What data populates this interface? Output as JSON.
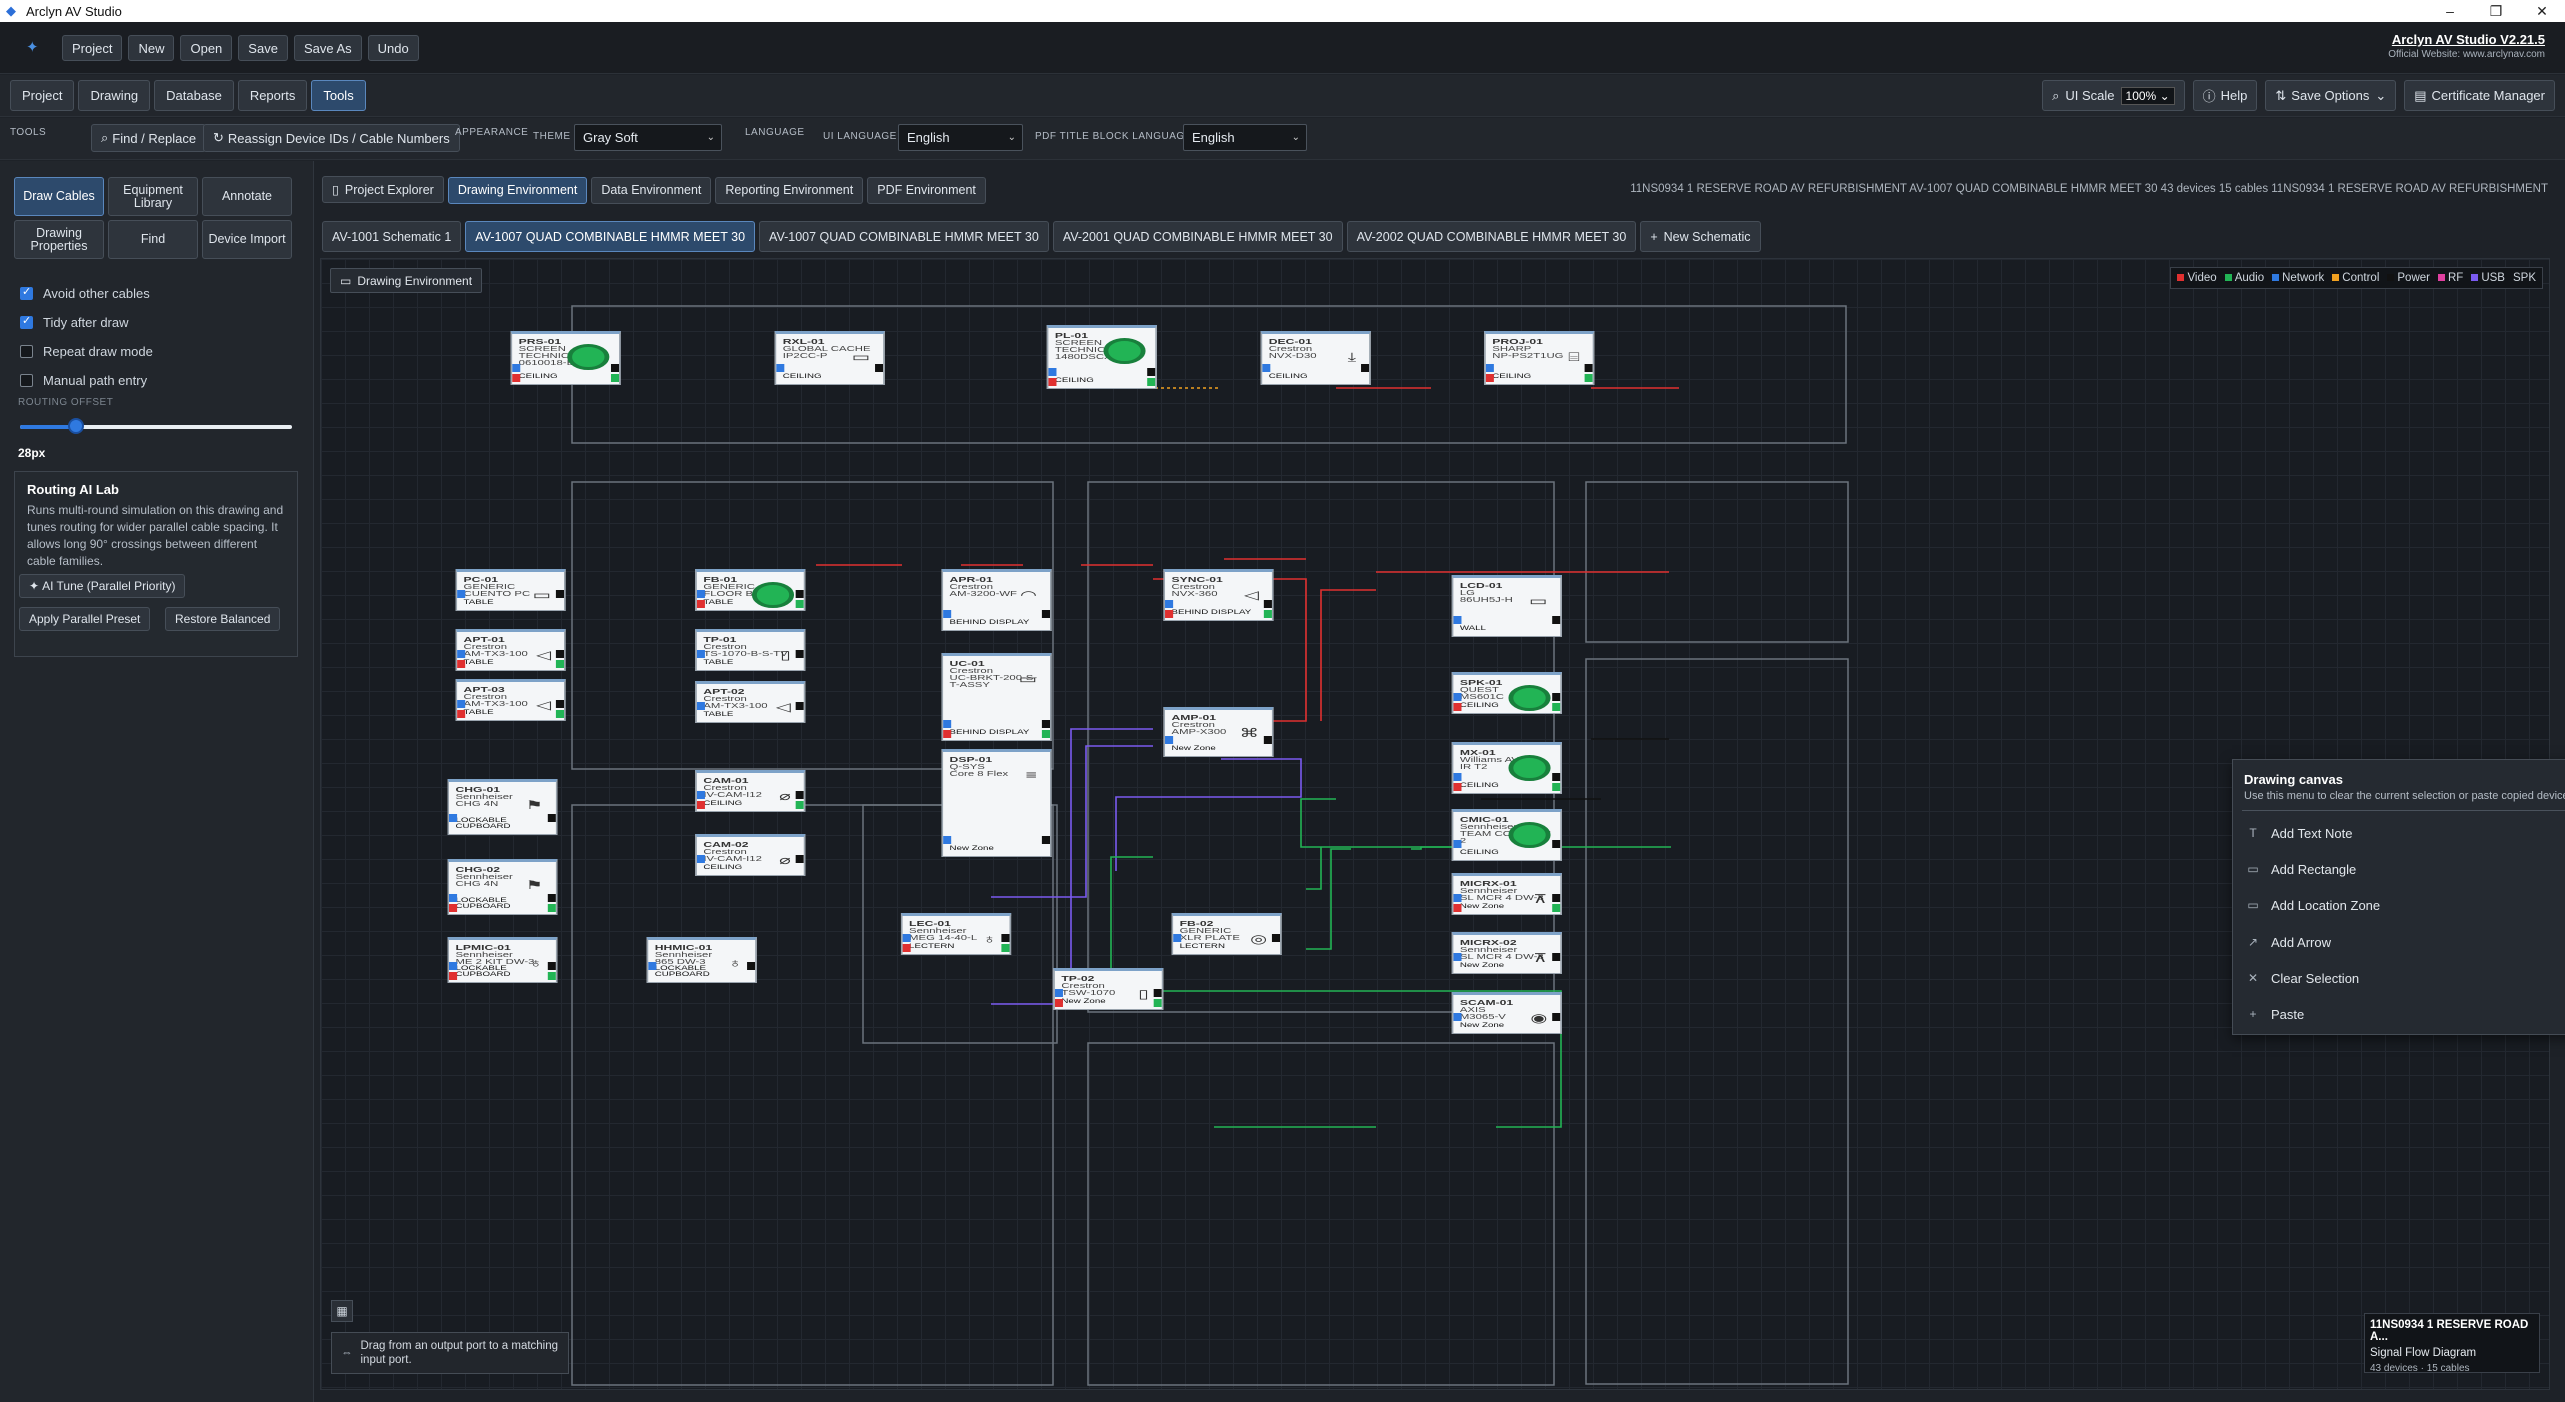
{
  "window": {
    "title": "Arclyn AV Studio",
    "controls": [
      "–",
      "❐",
      "✕"
    ]
  },
  "header": {
    "buttons": [
      "Project",
      "New",
      "Open",
      "Save",
      "Save As",
      "Undo"
    ],
    "brand_title": "Arclyn AV Studio V2.21.5",
    "brand_sub": "Official Website: www.arclynav.com"
  },
  "nav": {
    "tabs": [
      "Project",
      "Drawing",
      "Database",
      "Reports",
      "Tools"
    ],
    "active_tab": "Tools",
    "ui_scale_label": "UI Scale",
    "ui_scale_value": "100%",
    "help": "Help",
    "save_options": "Save Options",
    "certificate": "Certificate Manager"
  },
  "tools": {
    "section": "TOOLS",
    "find_replace": "Find / Replace",
    "reassign": "Reassign Device IDs / Cable Numbers",
    "appearance": "APPEARANCE",
    "theme_label": "THEME",
    "theme_value": "Gray Soft",
    "language": "LANGUAGE",
    "ui_language_label": "UI LANGUAGE",
    "ui_language_value": "English",
    "pdf_label": "PDF TITLE BLOCK LANGUAGE",
    "pdf_value": "English"
  },
  "left": {
    "tool_buttons": [
      "Draw Cables",
      "Equipment Library",
      "Annotate",
      "Drawing Properties",
      "Find",
      "Device Import"
    ],
    "checks": [
      {
        "label": "Avoid other cables",
        "on": true
      },
      {
        "label": "Tidy after draw",
        "on": true
      },
      {
        "label": "Repeat draw mode",
        "on": false
      },
      {
        "label": "Manual path entry",
        "on": false
      }
    ],
    "routing_offset_label": "ROUTING OFFSET",
    "routing_offset_value": "28px",
    "ai_title": "Routing AI Lab",
    "ai_desc": "Runs multi-round simulation on this drawing and tunes routing for wider parallel cable spacing. It allows long 90° crossings between different cable families.",
    "ai_tune": "AI Tune (Parallel Priority)",
    "apply_preset": "Apply Parallel Preset",
    "restore": "Restore Balanced"
  },
  "env": {
    "tabs": [
      "Project Explorer",
      "Drawing Environment",
      "Data Environment",
      "Reporting Environment",
      "PDF Environment"
    ],
    "active": "Drawing Environment",
    "info": "11NS0934 1 RESERVE ROAD AV REFURBISHMENT AV-1007 QUAD COMBINABLE HMMR MEET 30 43 devices 15 cables 11NS0934 1 RESERVE ROAD AV REFURBISHMENT"
  },
  "schematics": {
    "tabs": [
      "AV-1001 Schematic 1",
      "AV-1007 QUAD COMBINABLE HMMR MEET 30",
      "AV-1007 QUAD COMBINABLE HMMR MEET 30",
      "AV-2001 QUAD COMBINABLE HMMR MEET 30",
      "AV-2002 QUAD COMBINABLE HMMR MEET 30",
      "New Schematic"
    ],
    "active_index": 1
  },
  "canvas": {
    "chip": "Drawing Environment",
    "legend": [
      {
        "label": "Video",
        "color": "#e03030"
      },
      {
        "label": "Audio",
        "color": "#22b455"
      },
      {
        "label": "Network",
        "color": "#2f79e0"
      },
      {
        "label": "Control",
        "color": "#f0a020"
      },
      {
        "label": "Power",
        "color": "#111111"
      },
      {
        "label": "RF",
        "color": "#e040a0"
      },
      {
        "label": "USB",
        "color": "#7a5af0"
      },
      {
        "label": "SPK",
        "color": ""
      }
    ],
    "devices": [
      {
        "id": "PRS-01",
        "make": "SCREEN TECHNICS",
        "model": "0610018-B",
        "loc": "CEILING"
      },
      {
        "id": "RXL-01",
        "make": "GLOBAL CACHE",
        "model": "IP2CC-P",
        "loc": "CEILING"
      },
      {
        "id": "PL-01",
        "make": "SCREEN TECHNICS",
        "model": "1480DSCX",
        "loc": "CEILING"
      },
      {
        "id": "DEC-01",
        "make": "Crestron",
        "model": "NVX-D30",
        "loc": "CEILING"
      },
      {
        "id": "PROJ-01",
        "make": "SHARP",
        "model": "NP-PS2T1UG",
        "loc": "CEILING"
      },
      {
        "id": "PC-01",
        "make": "GENERIC",
        "model": "CUENTO PC",
        "loc": "TABLE"
      },
      {
        "id": "FB-01",
        "make": "GENERIC",
        "model": "FLOOR BOX",
        "loc": "TABLE"
      },
      {
        "id": "APR-01",
        "make": "Crestron",
        "model": "AM-3200-WF",
        "loc": "BEHIND DISPLAY"
      },
      {
        "id": "SYNC-01",
        "make": "Crestron",
        "model": "NVX-360",
        "loc": "BEHIND DISPLAY"
      },
      {
        "id": "LCD-01",
        "make": "LG",
        "model": "86UH5J-H",
        "loc": "WALL"
      },
      {
        "id": "APT-01",
        "make": "Crestron",
        "model": "AM-TX3-100",
        "loc": "TABLE"
      },
      {
        "id": "TP-01",
        "make": "Crestron",
        "model": "TS-1070-B-S-TV",
        "loc": "TABLE"
      },
      {
        "id": "UC-01",
        "make": "Crestron",
        "model": "UC-BRKT-200-S-T-ASSY",
        "loc": "BEHIND DISPLAY"
      },
      {
        "id": "APT-02",
        "make": "Crestron",
        "model": "AM-TX3-100",
        "loc": "TABLE"
      },
      {
        "id": "APT-03",
        "make": "Crestron",
        "model": "AM-TX3-100",
        "loc": "TABLE"
      },
      {
        "id": "AMP-01",
        "make": "Crestron",
        "model": "AMP-X300",
        "loc": "New Zone"
      },
      {
        "id": "SPK-01",
        "make": "QUEST",
        "model": "MS601C",
        "loc": "CEILING"
      },
      {
        "id": "DSP-01",
        "make": "Q-SYS",
        "model": "Core 8 Flex",
        "loc": "New Zone"
      },
      {
        "id": "MX-01",
        "make": "Williams AV",
        "model": "IR T2",
        "loc": "CEILING"
      },
      {
        "id": "CHG-01",
        "make": "Sennheiser",
        "model": "CHG 4N",
        "loc": "LOCKABLE CUPBOARD"
      },
      {
        "id": "CAM-01",
        "make": "Crestron",
        "model": "IV-CAM-I12",
        "loc": "CEILING"
      },
      {
        "id": "CMIC-01",
        "make": "Sennheiser",
        "model": "TEAM CONNECT 2",
        "loc": "CEILING"
      },
      {
        "id": "CHG-02",
        "make": "Sennheiser",
        "model": "CHG 4N",
        "loc": "LOCKABLE CUPBOARD"
      },
      {
        "id": "CAM-02",
        "make": "Crestron",
        "model": "IV-CAM-I12",
        "loc": "CEILING"
      },
      {
        "id": "MICRX-01",
        "make": "Sennheiser",
        "model": "SL MCR 4 DW-3",
        "loc": "New Zone"
      },
      {
        "id": "MICRX-02",
        "make": "Sennheiser",
        "model": "SL MCR 4 DW-3",
        "loc": "New Zone"
      },
      {
        "id": "LPMIC-01",
        "make": "Sennheiser",
        "model": "ME 2 KIT DW-3",
        "loc": "LOCKABLE CUPBOARD"
      },
      {
        "id": "HHMIC-01",
        "make": "Sennheiser",
        "model": "865 DW-3",
        "loc": "LOCKABLE CUPBOARD"
      },
      {
        "id": "LEC-01",
        "make": "Sennheiser",
        "model": "MEG 14-40-L",
        "loc": "LECTERN"
      },
      {
        "id": "FB-02",
        "make": "GENERIC",
        "model": "XLR PLATE",
        "loc": "LECTERN"
      },
      {
        "id": "TP-02",
        "make": "Crestron",
        "model": "TSW-1070",
        "loc": "New Zone"
      },
      {
        "id": "SCAM-01",
        "make": "AXIS",
        "model": "M3065-V",
        "loc": "New Zone"
      }
    ]
  },
  "context_menu": {
    "title": "Drawing canvas",
    "subtitle": "Use this menu to clear the current selection or paste copied devices.",
    "items": [
      {
        "icon": "T",
        "label": "Add Text Note"
      },
      {
        "icon": "▭",
        "label": "Add Rectangle"
      },
      {
        "icon": "▭",
        "label": "Add Location Zone"
      },
      {
        "icon": "↗",
        "label": "Add Arrow"
      },
      {
        "icon": "✕",
        "label": "Clear Selection"
      },
      {
        "icon": "+",
        "label": "Paste"
      }
    ]
  },
  "footer": {
    "hint": "Drag from an output port to a matching input port.",
    "info_title": "11NS0934 1 RESERVE ROAD A...",
    "info_sub": "Signal Flow Diagram",
    "info_count": "43 devices · 15 cables"
  }
}
